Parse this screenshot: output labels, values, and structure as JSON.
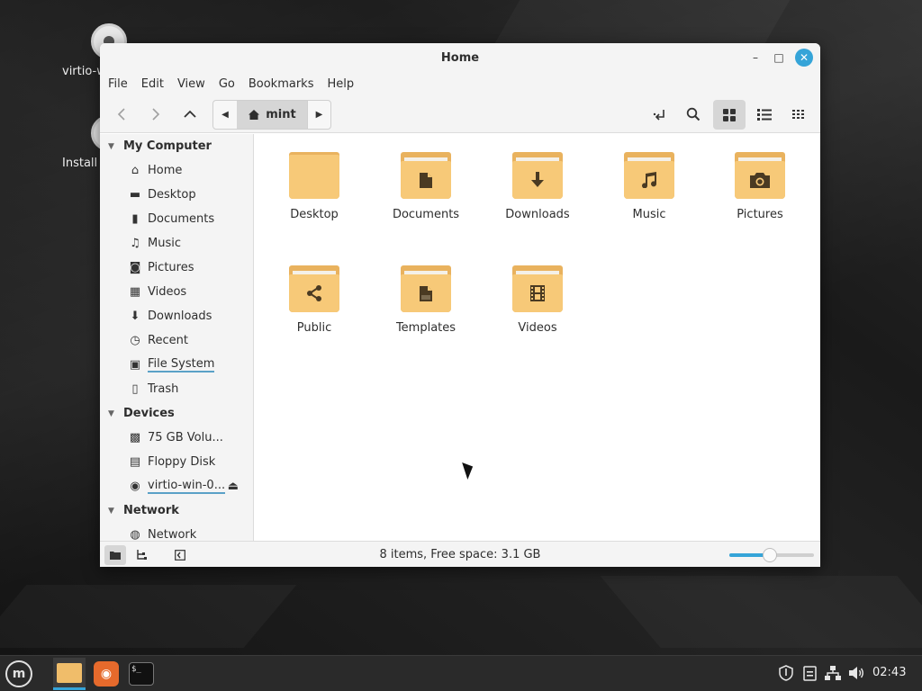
{
  "desktop": {
    "icons": [
      {
        "label": "virtio-w"
      },
      {
        "label": "Install"
      }
    ]
  },
  "window": {
    "title": "Home",
    "controls": {
      "minimize": "–",
      "maximize": "□",
      "close": "✕"
    }
  },
  "menubar": {
    "items": [
      "File",
      "Edit",
      "View",
      "Go",
      "Bookmarks",
      "Help"
    ]
  },
  "toolbar": {
    "path_crumb": "mint",
    "back_glyph": "〈",
    "forward_glyph": "〉",
    "up_glyph": "︿"
  },
  "sidebar": {
    "sections": [
      {
        "title": "My Computer",
        "items": [
          {
            "label": "Home",
            "icon": "home-icon"
          },
          {
            "label": "Desktop",
            "icon": "desktop-icon"
          },
          {
            "label": "Documents",
            "icon": "documents-icon"
          },
          {
            "label": "Music",
            "icon": "music-icon"
          },
          {
            "label": "Pictures",
            "icon": "camera-icon"
          },
          {
            "label": "Videos",
            "icon": "film-icon"
          },
          {
            "label": "Downloads",
            "icon": "download-icon"
          },
          {
            "label": "Recent",
            "icon": "clock-icon"
          },
          {
            "label": "File System",
            "icon": "drive-icon"
          },
          {
            "label": "Trash",
            "icon": "trash-icon"
          }
        ]
      },
      {
        "title": "Devices",
        "items": [
          {
            "label": "75 GB Volu...",
            "icon": "chip-icon"
          },
          {
            "label": "Floppy Disk",
            "icon": "floppy-icon"
          },
          {
            "label": "virtio-win-0...",
            "icon": "disc-icon"
          }
        ]
      },
      {
        "title": "Network",
        "items": [
          {
            "label": "Network",
            "icon": "globe-icon"
          }
        ]
      }
    ]
  },
  "files": [
    {
      "label": "Desktop",
      "icon": "folder-icon"
    },
    {
      "label": "Documents",
      "icon": "folder-documents-icon"
    },
    {
      "label": "Downloads",
      "icon": "folder-download-icon"
    },
    {
      "label": "Music",
      "icon": "folder-music-icon"
    },
    {
      "label": "Pictures",
      "icon": "folder-camera-icon"
    },
    {
      "label": "Public",
      "icon": "folder-share-icon"
    },
    {
      "label": "Templates",
      "icon": "folder-templates-icon"
    },
    {
      "label": "Videos",
      "icon": "folder-film-icon"
    }
  ],
  "statusbar": {
    "text": "8 items, Free space: 3.1 GB",
    "zoom_fraction": 0.48
  },
  "taskbar": {
    "clock": "02:43",
    "terminal_prompt": "$_"
  },
  "colors": {
    "accent": "#35a4d8",
    "folder": "#f7c978"
  }
}
